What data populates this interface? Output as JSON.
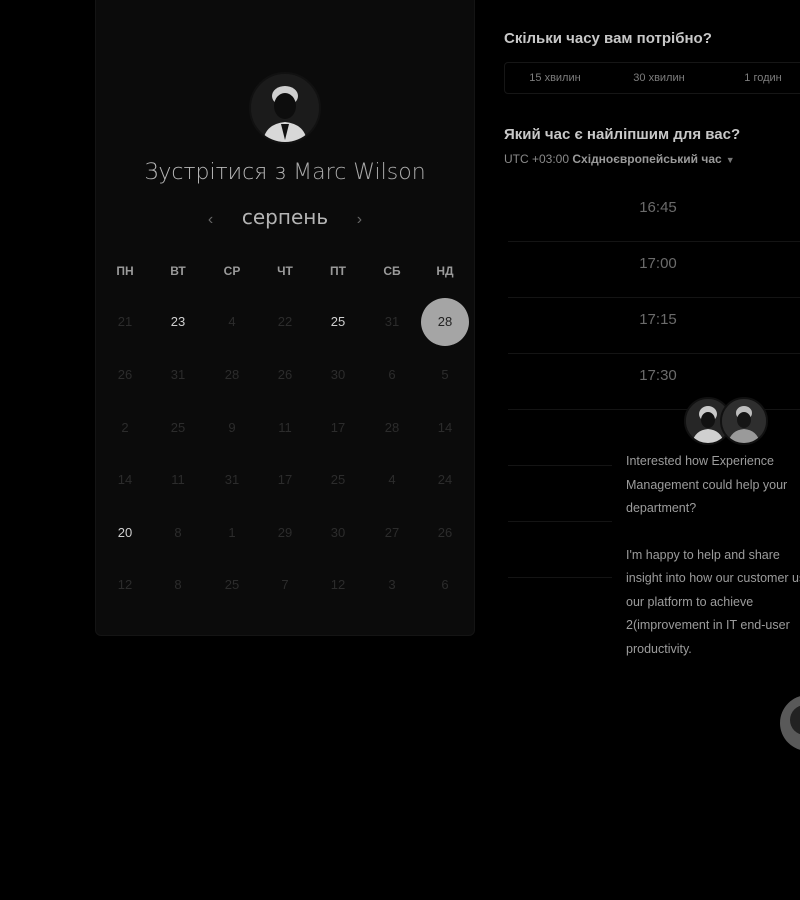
{
  "host": {
    "name": "Marc Wilson"
  },
  "title": {
    "prefix": "Зустрітися з ",
    "name": "Marc Wilson"
  },
  "calendar": {
    "month": "серпень",
    "prev_icon": "chevron-left-icon",
    "next_icon": "chevron-right-icon",
    "weekdays": [
      "ПН",
      "ВТ",
      "СР",
      "ЧТ",
      "ПТ",
      "СБ",
      "НД"
    ],
    "rows": [
      [
        "21",
        "23",
        "4",
        "22",
        "25",
        "31",
        "28"
      ],
      [
        "26",
        "31",
        "28",
        "26",
        "30",
        "6",
        "5"
      ],
      [
        "2",
        "25",
        "9",
        "11",
        "17",
        "28",
        "14"
      ],
      [
        "14",
        "11",
        "31",
        "17",
        "25",
        "4",
        "24"
      ],
      [
        "20",
        "8",
        "1",
        "29",
        "30",
        "27",
        "26"
      ],
      [
        "12",
        "8",
        "25",
        "7",
        "12",
        "3",
        "6"
      ]
    ],
    "available": [
      "0-1",
      "0-4",
      "4-0"
    ],
    "selected": "0-6"
  },
  "duration": {
    "question": "Скільки часу вам потрібно?",
    "options": [
      "15 хвилин",
      "30 хвилин",
      "1 годин"
    ]
  },
  "time": {
    "question": "Який час є найліпшим для вас?",
    "tz_offset": "UTC +03:00",
    "tz_name": "Східноєвропейський час",
    "slots": [
      "16:45",
      "17:00",
      "17:15",
      "17:30"
    ]
  },
  "chat": {
    "message_1": "Interested how Experience Management could help your department?",
    "message_2": "I'm happy to help and share insight into how our customer use our platform to achieve 2(improvement in IT end-user productivity."
  },
  "colors": {
    "background": "#000000",
    "selected_day": "#a5a5a5",
    "text": "#cccccc"
  }
}
